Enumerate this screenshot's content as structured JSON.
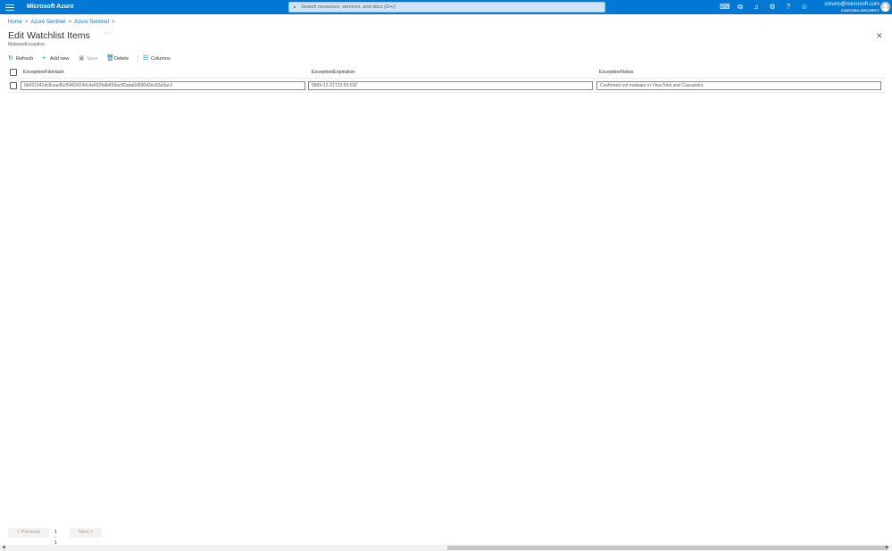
{
  "topbar": {
    "brand": "Microsoft Azure",
    "search_placeholder": "Search resources, services, and docs (G+/)",
    "account_email": "cmuno@microsoft.com",
    "account_tenant": "CONTOSO-SECURITY",
    "icons": [
      "cloud-shell-icon",
      "directory-filter-icon",
      "notifications-icon",
      "settings-icon",
      "help-icon",
      "feedback-icon"
    ]
  },
  "breadcrumb": {
    "items": [
      "Home",
      "Azure Sentinel",
      "Azure Sentinel"
    ],
    "separator": ">"
  },
  "page": {
    "title": "Edit Watchlist Items",
    "more": "···",
    "subtitle": "MalwareException",
    "close": "✕"
  },
  "toolbar": {
    "refresh": "Refresh",
    "add_new": "Add new",
    "save": "Save",
    "delete": "Delete",
    "columns": "Columns"
  },
  "table": {
    "columns": [
      "ExceptionFileHash",
      "ExceptionExpiration",
      "ExceptionNotes"
    ],
    "rows": [
      {
        "hash": "9b051041dc8cea45cf54694244c4e692fa8df3dacff2ada6d990d3ec83a3ac3",
        "expiration": "9999-12-31T23:59:59Z",
        "notes": "Confirmed not malware in VirusTotal and Cassandra"
      }
    ]
  },
  "pager": {
    "previous": "< Previous",
    "range": "1 - 1",
    "next": "Next >"
  },
  "colors": {
    "accent": "#0078d4",
    "header_bg": "#0078d4"
  }
}
